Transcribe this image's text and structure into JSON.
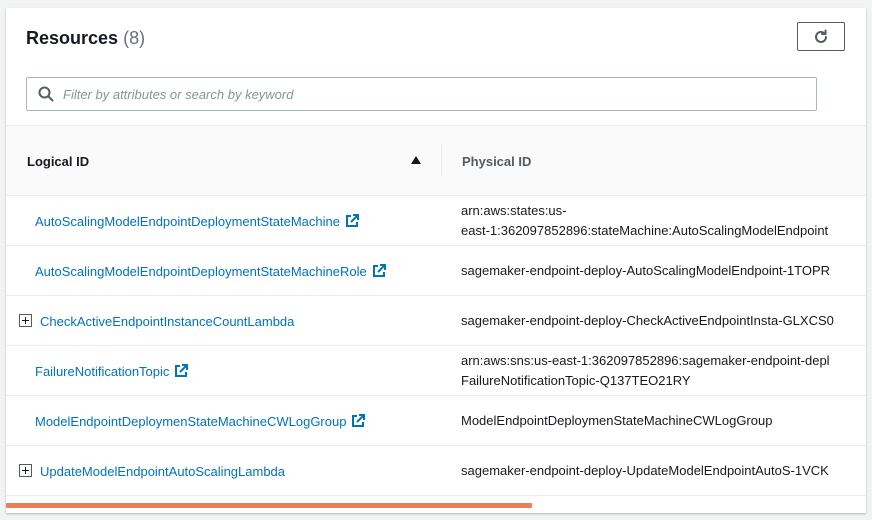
{
  "header": {
    "title": "Resources",
    "count": "(8)",
    "search_placeholder": "Filter by attributes or search by keyword"
  },
  "table": {
    "columns": [
      "Logical ID",
      "Physical ID"
    ],
    "sort": {
      "column": "Logical ID",
      "direction": "ascending"
    },
    "rows": [
      {
        "logical_id": "AutoScalingModelEndpointDeploymentStateMachine",
        "icon": "external-link-icon",
        "physical_lines": [
          "arn:aws:states:us-",
          "east-1:362097852896:stateMachine:AutoScalingModelEndpoint"
        ]
      },
      {
        "logical_id": "AutoScalingModelEndpointDeploymentStateMachineRole",
        "icon": "external-link-icon",
        "physical_lines": [
          "sagemaker-endpoint-deploy-AutoScalingModelEndpoint-1TOPR"
        ]
      },
      {
        "logical_id": "CheckActiveEndpointInstanceCountLambda",
        "icon": "expand-icon",
        "physical_lines": [
          "sagemaker-endpoint-deploy-CheckActiveEndpointInsta-GLXCS0"
        ]
      },
      {
        "logical_id": "FailureNotificationTopic",
        "icon": "external-link-icon",
        "physical_lines": [
          "arn:aws:sns:us-east-1:362097852896:sagemaker-endpoint-depl",
          "FailureNotificationTopic-Q137TEO21RY"
        ]
      },
      {
        "logical_id": "ModelEndpointDeploymenStateMachineCWLogGroup",
        "icon": "external-link-icon",
        "physical_lines": [
          "ModelEndpointDeploymenStateMachineCWLogGroup"
        ]
      },
      {
        "logical_id": "UpdateModelEndpointAutoScalingLambda",
        "icon": "expand-icon",
        "physical_lines": [
          "sagemaker-endpoint-deploy-UpdateModelEndpointAutoS-1VCK"
        ]
      }
    ]
  },
  "colors": {
    "link": "#0073bb",
    "text": "#16191f",
    "muted": "#687078",
    "scrollbar_thumb": "#ec7d58"
  }
}
